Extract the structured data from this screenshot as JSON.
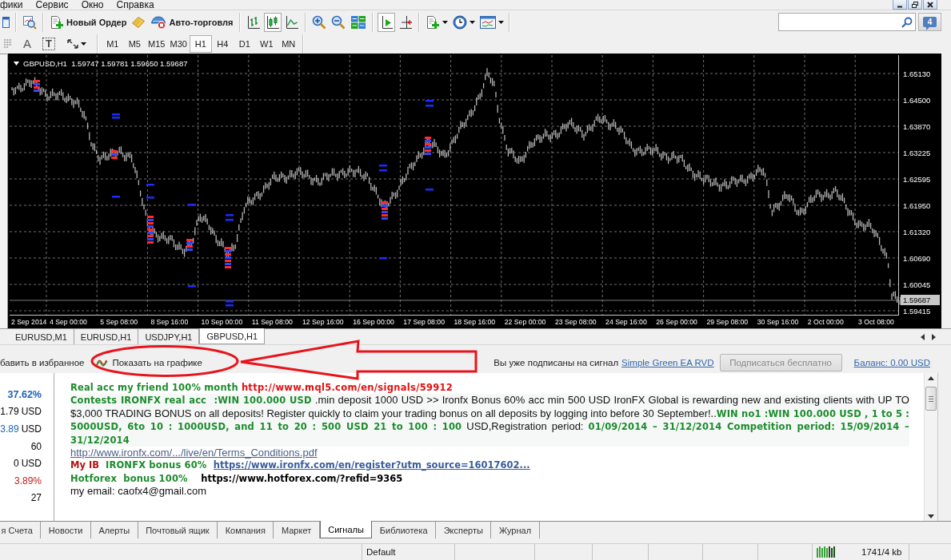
{
  "menu": [
    "фики",
    "Сервис",
    "Окно",
    "Справка"
  ],
  "window_controls": [
    {
      "kind": "minimize"
    },
    {
      "kind": "restore"
    },
    {
      "kind": "close"
    }
  ],
  "toolbar": [
    {
      "items": [
        {
          "kind": "window",
          "pressed": false,
          "dropdown": false
        }
      ]
    },
    {
      "items": [
        {
          "kind": "chart-zoom",
          "pressed": false,
          "dropdown": false
        }
      ]
    },
    {
      "items": [
        {
          "kind": "new-order",
          "label": "Новый Ордер",
          "pressed": false,
          "dropdown": false
        },
        {
          "kind": "notepad",
          "pressed": false,
          "dropdown": false
        },
        {
          "kind": "auto-trading",
          "label": "Авто-торговля",
          "pressed": false,
          "dropdown": false
        }
      ]
    },
    {
      "items": [
        {
          "kind": "bars",
          "pressed": false,
          "dropdown": false
        },
        {
          "kind": "candles",
          "pressed": true,
          "dropdown": false
        },
        {
          "kind": "line",
          "pressed": false,
          "dropdown": false
        }
      ]
    },
    {
      "items": [
        {
          "kind": "zoom-in",
          "pressed": false,
          "dropdown": false
        },
        {
          "kind": "zoom-out",
          "pressed": false,
          "dropdown": false
        },
        {
          "kind": "tile",
          "pressed": false,
          "dropdown": false
        }
      ]
    },
    {
      "items": [
        {
          "kind": "shift",
          "pressed": true,
          "dropdown": false
        },
        {
          "kind": "autoscroll",
          "pressed": false,
          "dropdown": false
        }
      ]
    },
    {
      "items": [
        {
          "kind": "new-chart",
          "pressed": false,
          "dropdown": true
        },
        {
          "kind": "periods",
          "pressed": false,
          "dropdown": true
        },
        {
          "kind": "templates",
          "pressed": false,
          "dropdown": true
        }
      ]
    }
  ],
  "messages": {
    "count": "4"
  },
  "drawing_tools": [
    {
      "kind": "dotted-lines",
      "dropdown": false
    },
    {
      "kind": "letter",
      "label": "A",
      "dropdown": false
    },
    {
      "kind": "boxed-letter",
      "label": "T",
      "dropdown": false
    },
    {
      "kind": "arrows",
      "dropdown": true
    }
  ],
  "timeframes": [
    {
      "label": "M1",
      "selected": false
    },
    {
      "label": "M5",
      "selected": false
    },
    {
      "label": "M15",
      "selected": false
    },
    {
      "label": "M30",
      "selected": false
    },
    {
      "label": "H1",
      "selected": true
    },
    {
      "label": "H4",
      "selected": false
    },
    {
      "label": "D1",
      "selected": false
    },
    {
      "label": "W1",
      "selected": false
    },
    {
      "label": "MN",
      "selected": false
    }
  ],
  "chart": {
    "title": "GBPUSD,H1  1.59747 1.59781 1.59650 1.59687",
    "price_labels": [
      "1.65130",
      "1.64500",
      "1.63870",
      "1.63225",
      "1.62595",
      "1.61950",
      "1.61320",
      "1.60690",
      "1.60045",
      "1.59415"
    ],
    "current_price": "1.59687",
    "time_labels": [
      "2 Sep 2014",
      "4 Sep 00:00",
      "5 Sep 08:00",
      "8 Sep 16:00",
      "10 Sep 00:00",
      "11 Sep 08:00",
      "12 Sep 16:00",
      "16 Sep 00:00",
      "17 Sep 08:00",
      "18 Sep 16:00",
      "22 Sep 00:00",
      "23 Sep 08:00",
      "24 Sep 16:00",
      "26 Sep 00:00",
      "29 Sep 08:00",
      "30 Sep 16:00",
      "2 Oct 00:00",
      "3 Oct 08:00"
    ]
  },
  "chart_tabs": [
    {
      "label": "EURUSD,M1",
      "selected": false
    },
    {
      "label": "EURUSD,H1",
      "selected": false
    },
    {
      "label": "USDJPY,H1",
      "selected": false
    },
    {
      "label": "GBPUSD,H1",
      "selected": true
    }
  ],
  "signal_bar": {
    "favorite_link": "бавить в избранное",
    "show_on_chart": "Показать на графике",
    "subscribed_text": "Вы уже подписаны на сигнал",
    "signal_link": "Simple Green EA RVD",
    "subscribe_button": {
      "label": "Подписаться бесплатно",
      "disabled": true
    },
    "balance_link": "Баланс: 0.00 USD"
  },
  "stats": [
    {
      "value": "37.62%",
      "kind": "headline",
      "color": "#1d63b0"
    },
    {
      "value": "1.79",
      "unit": "USD",
      "kind": "plain"
    },
    {
      "value": "3.89",
      "unit": "USD",
      "kind": "plain",
      "color": "#1d63b0"
    },
    {
      "value": "60",
      "kind": "plain"
    },
    {
      "value": "0",
      "unit": "USD",
      "kind": "plain"
    },
    {
      "value": "3.89%",
      "kind": "plain",
      "color": "#c0201c"
    },
    {
      "value": "27",
      "kind": "plain"
    }
  ],
  "description": [
    {
      "kind": "line",
      "segments": [
        {
          "kind": "highlight",
          "text": "Real acc my friend 100% month "
        },
        {
          "kind": "url",
          "text": "http://www.mql5.com/en/signals/59912"
        }
      ]
    },
    {
      "kind": "paragraph",
      "segments": [
        {
          "kind": "highlight",
          "text": "Contests IRONFX real acc  :WIN 100.000 USD"
        },
        {
          "kind": "plain",
          "text": " .min deposit 1000 USD >> Ironfx Bonus 60% acc min 500 USD IronFX Global is rewarding new and existing clients with UP TO $3,000 TRADING BONUS on all deposits! Register quickly to claim your trading bonus on all deposits by logging into before 30 September!.."
        },
        {
          "kind": "highlight",
          "text": "WIN no1 :WIN 100.000 USD , 1 to 5 : 5000USD, 6to 10 : 1000USD, and 11 to 20 : 500 USD 21 to 100 : 100"
        },
        {
          "kind": "plain",
          "text": " USD,Registration period: "
        },
        {
          "kind": "highlight",
          "text": "01/09/2014 – 31/12/2014 Competition period: 15/09/2014 – 31/12/2014"
        }
      ]
    },
    {
      "kind": "line",
      "segments": [
        {
          "kind": "link",
          "text": "http://www.ironfx.com/.../live/en/Terms_Conditions.pdf"
        }
      ]
    },
    {
      "kind": "line",
      "segments": [
        {
          "kind": "label",
          "text": "My IB  "
        },
        {
          "kind": "highlight",
          "text": "IRONFX bonus 60%  "
        },
        {
          "kind": "bold-link",
          "text": "https://www.ironfx.com/en/register?utm_source=16017602..."
        }
      ]
    },
    {
      "kind": "line",
      "segments": [
        {
          "kind": "highlight",
          "text": "Hotforex  bonus 100%    "
        },
        {
          "kind": "bold",
          "text": "https://www.hotforex.com/?refid=9365"
        }
      ]
    },
    {
      "kind": "line",
      "segments": [
        {
          "kind": "plain",
          "text": "my email: caofx4@gmail.com"
        }
      ]
    }
  ],
  "bottom_tabs": [
    {
      "label": "я Счета",
      "selected": false
    },
    {
      "label": "Новости",
      "selected": false
    },
    {
      "label": "Алерты",
      "selected": false
    },
    {
      "label": "Почтовый ящик",
      "selected": false
    },
    {
      "label": "Компания",
      "selected": false
    },
    {
      "label": "Маркет",
      "selected": false
    },
    {
      "label": "Сигналы",
      "selected": true
    },
    {
      "label": "Библиотека",
      "selected": false
    },
    {
      "label": "Эксперты",
      "selected": false
    },
    {
      "label": "Журнал",
      "selected": false
    }
  ],
  "status_bar": {
    "profile": "Default",
    "traffic": "1741/4 kb"
  }
}
